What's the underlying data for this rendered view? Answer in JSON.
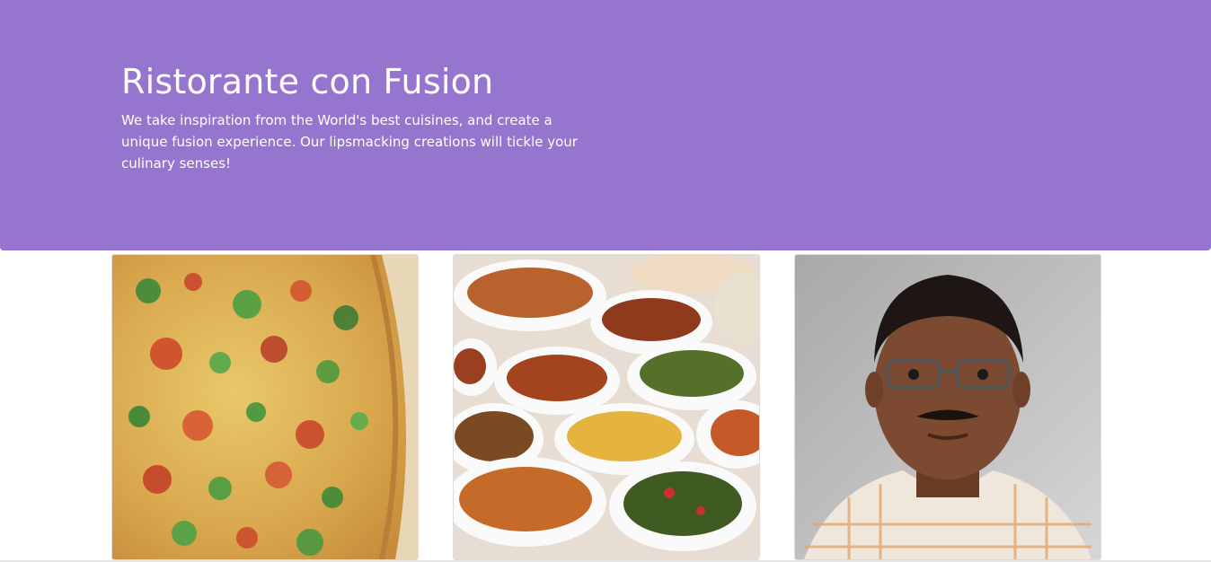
{
  "jumbotron": {
    "title": "Ristorante con Fusion",
    "description": "We take inspiration from the World's best cuisines, and create a unique fusion experience. Our lipsmacking creations will tickle your culinary senses!",
    "background_color": "#9575cd",
    "text_color": "#ffffff"
  },
  "cards": [
    {
      "image": "pizza-photo"
    },
    {
      "image": "buffet-dishes-photo"
    },
    {
      "image": "chef-portrait-photo"
    }
  ]
}
